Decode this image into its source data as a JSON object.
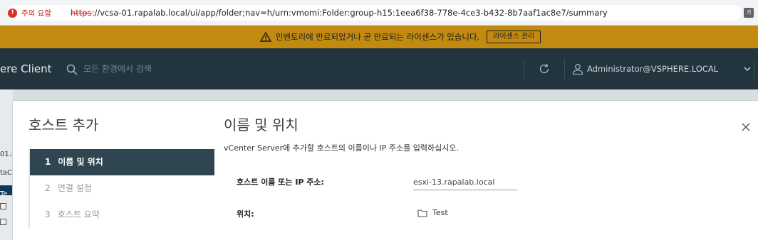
{
  "browser": {
    "security_label": "주의 요함",
    "url_protocol": "https",
    "url_rest": "://vcsa-01.rapalab.local/ui/app/folder;nav=h/urn:vmomi:Folder:group-h15:1eea6f38-778e-4ce3-b432-8b7aaf1ac8e7/summary",
    "icons": [
      "warning-dot-icon",
      "translate-icon"
    ]
  },
  "banner": {
    "message": "인벤토리에 만료되었거나 곧 만료되는 라이센스가 있습니다.",
    "button_label": "라이센스 관리",
    "icons": [
      "warning-triangle-icon"
    ]
  },
  "header": {
    "app_title": "ere Client",
    "search_placeholder": "모든 환경에서 검색",
    "user": "Administrator@VSPHERE.LOCAL",
    "icons": [
      "search-icon",
      "refresh-icon",
      "user-icon",
      "chevron-down-icon"
    ]
  },
  "background": {
    "line1": "01.r",
    "line2": "taC",
    "selected": "Te"
  },
  "wizard": {
    "title": "호스트 추가",
    "steps": [
      {
        "num": "1",
        "label": "이름 및 위치"
      },
      {
        "num": "2",
        "label": "연결 설정"
      },
      {
        "num": "3",
        "label": "호스트 요약"
      }
    ],
    "active_step": 1
  },
  "pane": {
    "title": "이름 및 위치",
    "description": "vCenter Server에 추가할 호스트의 이름이나 IP 주소를 입력하십시오.",
    "host_label": "호스트 이름 또는 IP 주소:",
    "host_value": "esxi-13.rapalab.local",
    "location_label": "위치:",
    "location_value": "Test",
    "icons": [
      "close-icon",
      "folder-icon"
    ]
  },
  "colors": {
    "banner": "#c28b10",
    "header": "#22343d",
    "active_step": "#2f4650",
    "danger": "#d93025"
  }
}
